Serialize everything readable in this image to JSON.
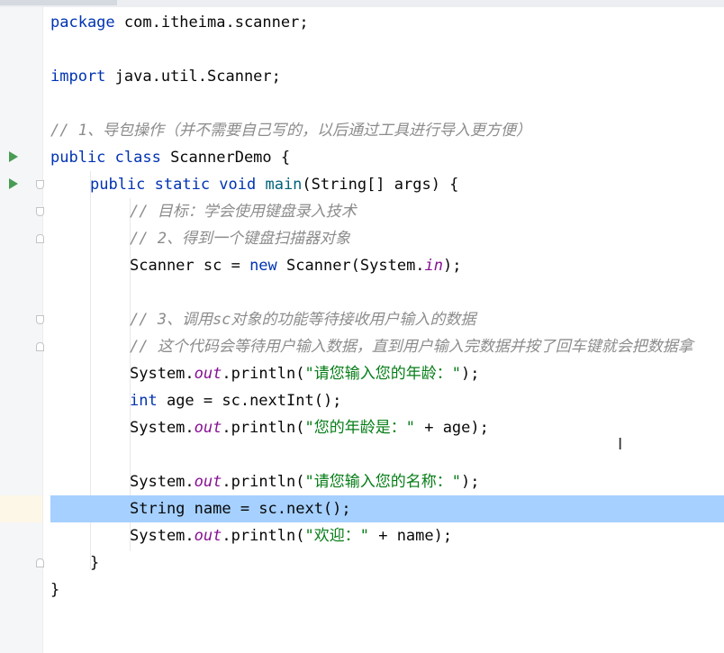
{
  "editor": {
    "file_class": "ScannerDemo",
    "lines": {
      "l1_kw": "package",
      "l1_rest": " com.itheima.scanner;",
      "l3_kw": "import",
      "l3_rest": " java.util.Scanner;",
      "l5_comment": "// 1、导包操作（并不需要自己写的，以后通过工具进行导入更方便）",
      "l6_kw": "public class",
      "l6_rest": " ScannerDemo {",
      "l7_kw": "public static void",
      "l7_meth": " main",
      "l7_rest": "(String[] args) {",
      "l8_comment": "// 目标：学会使用键盘录入技术",
      "l9_comment": "// 2、得到一个键盘扫描器对象",
      "l10_a": "Scanner sc = ",
      "l10_kw": "new",
      "l10_b": " Scanner(System.",
      "l10_fld": "in",
      "l10_c": ");",
      "l12_comment": "// 3、调用sc对象的功能等待接收用户输入的数据",
      "l13_comment": "// 这个代码会等待用户输入数据，直到用户输入完数据并按了回车键就会把数据拿",
      "l14_a": "System.",
      "l14_fld": "out",
      "l14_b": ".println(",
      "l14_str": "\"请您输入您的年龄：\"",
      "l14_c": ");",
      "l15_kw": "int",
      "l15_rest": " age = sc.nextInt();",
      "l16_a": "System.",
      "l16_fld": "out",
      "l16_b": ".println(",
      "l16_str": "\"您的年龄是：\"",
      "l16_c": " + age);",
      "l18_a": "System.",
      "l18_fld": "out",
      "l18_b": ".println(",
      "l18_str": "\"请您输入您的名称：\"",
      "l18_c": ");",
      "l19": "String name = sc.next();",
      "l20_a": "System.",
      "l20_fld": "out",
      "l20_b": ".println(",
      "l20_str": "\"欢迎：\"",
      "l20_c": " + name);",
      "l21": "}",
      "l22": "}"
    }
  },
  "gutter": {
    "run_icons": [
      "run-class-icon",
      "run-main-icon"
    ]
  },
  "colors": {
    "keyword": "#0033b3",
    "comment": "#8c8c8c",
    "string": "#067d17",
    "field": "#871094",
    "highlight": "#a5d0ff"
  }
}
